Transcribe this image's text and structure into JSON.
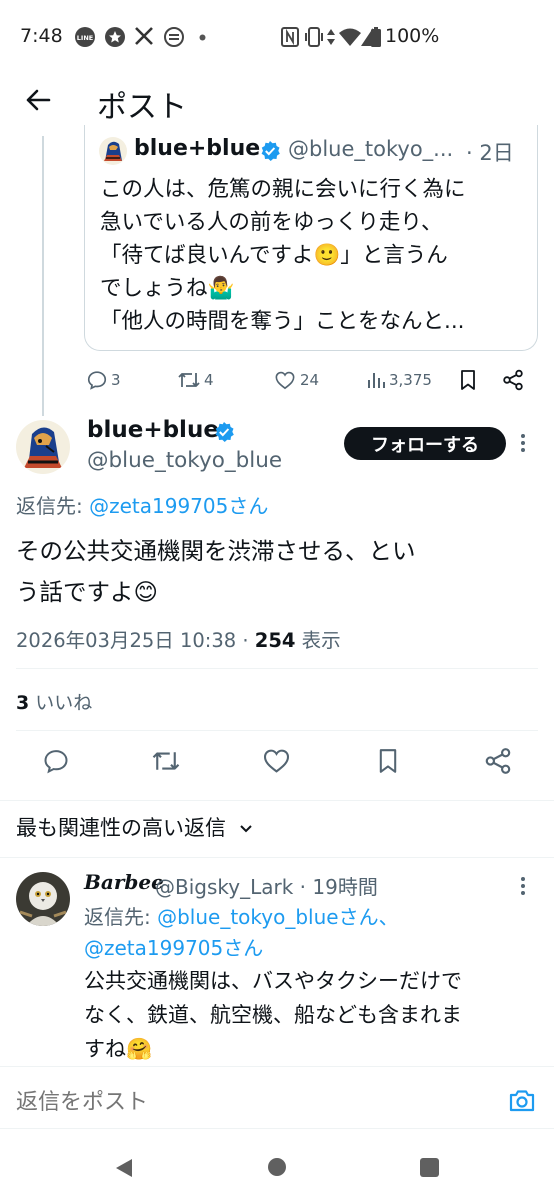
{
  "status_bar": {
    "time": "7:48",
    "left_icons": [
      "line-icon",
      "star-icon",
      "x-icon",
      "app-icon",
      "dot-icon"
    ],
    "right_icons": [
      "nfc-icon",
      "vibrate-icon",
      "data-icon",
      "wifi-icon",
      "signal-icon",
      "battery-icon"
    ],
    "battery": "100%"
  },
  "header": {
    "title": "ポスト"
  },
  "quote": {
    "name": "blue+blue",
    "handle": "@blue_tokyo_...",
    "time": "· 2日",
    "lines": [
      "この人は、危篤の親に会いに行く為に",
      "急いでいる人の前をゆっくり走り、",
      "「待てば良いんですよ🙂」と言うん",
      "でしょうね🤷‍♂️",
      "「他人の時間を奪う」ことをなんと..."
    ]
  },
  "actions_quote": {
    "replies": "3",
    "reposts": "4",
    "likes": "24",
    "views": "3,375"
  },
  "main": {
    "name": "blue+blue",
    "handle": "@blue_tokyo_blue",
    "follow_label": "フォローする",
    "reply_to_prefix": "返信先: ",
    "reply_to_user": "@zeta199705さん",
    "text_line1": "その公共交通機関を渋滞させる、とい",
    "text_line2": "う話ですよ😊",
    "date": "2026年03月25日 10:38 · ",
    "views_count": "254",
    "views_label": " 表示",
    "likes_count": "3",
    "likes_label": " いいね"
  },
  "sort": {
    "label": "最も関連性の高い返信"
  },
  "reply": {
    "name": "Barbee",
    "handle": "@Bigsky_Lark · 19時間",
    "reply_to_prefix": "返信先: ",
    "reply_to_user1": "@blue_tokyo_blueさん、",
    "reply_to_user2": "@zeta199705さん",
    "text_line1": "公共交通機関は、バスやタクシーだけで",
    "text_line2": "なく、鉄道、航空機、船なども含まれま",
    "text_line3": "すね🤗"
  },
  "composer": {
    "placeholder": "返信をポスト"
  },
  "colors": {
    "accent": "#1d9bf0",
    "text": "#0f1419",
    "secondary": "#536471",
    "border": "#cfd9de"
  }
}
